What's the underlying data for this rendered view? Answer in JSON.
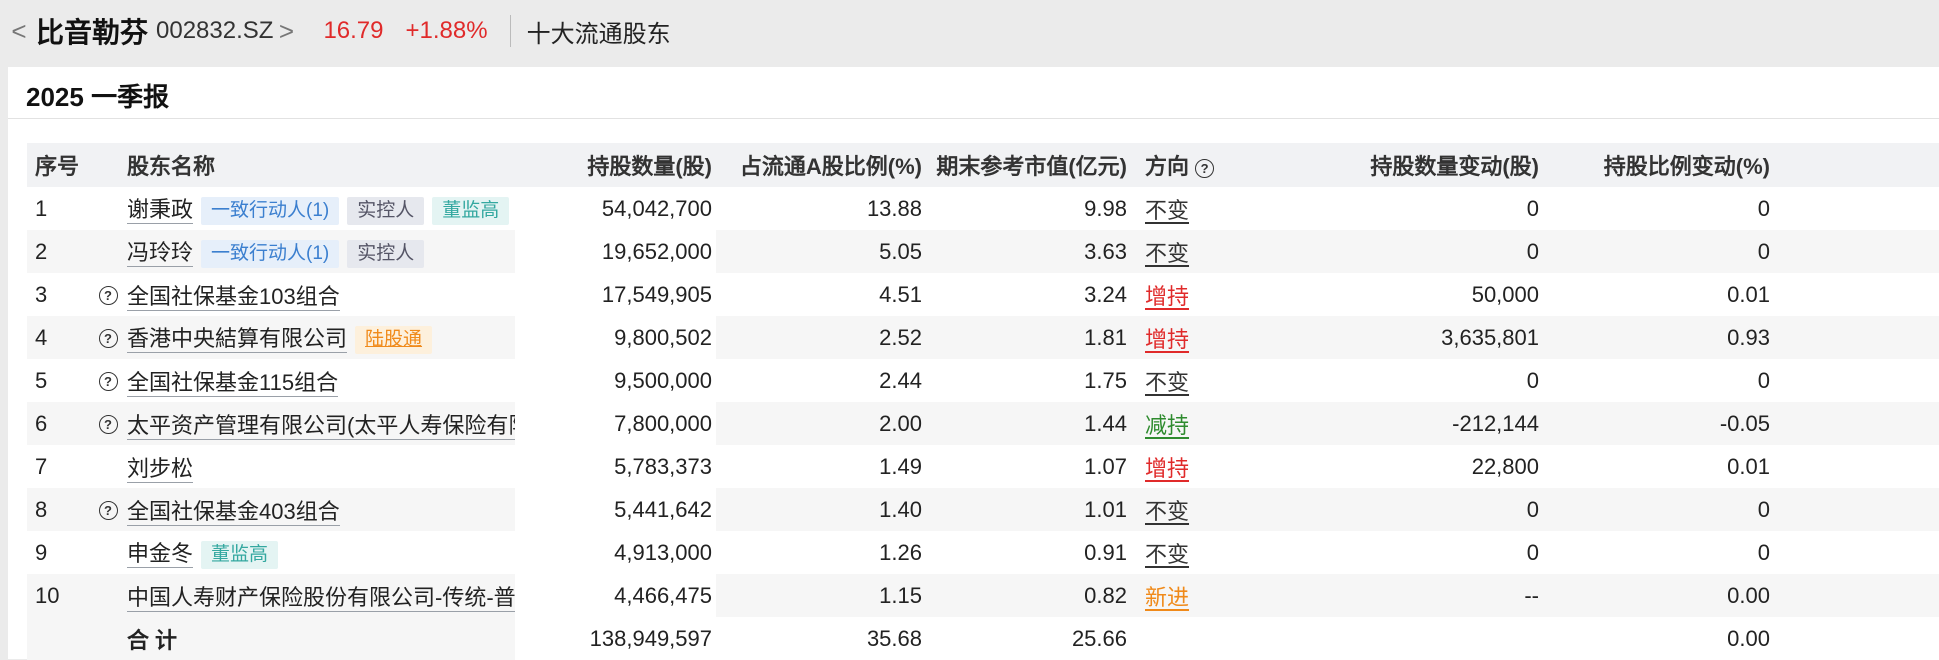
{
  "header": {
    "back_glyph": "<",
    "stock_name": "比音勒芬",
    "stock_code": "002832.SZ",
    "forward_glyph": ">",
    "price": "16.79",
    "change_pct": "+1.88%",
    "section": "十大流通股东"
  },
  "report": {
    "title": "2025 一季报"
  },
  "table": {
    "columns": {
      "idx": "序号",
      "name": "股东名称",
      "shares": "持股数量(股)",
      "ratio": "占流通A股比例(%)",
      "value": "期末参考市值(亿元)",
      "direction": "方向",
      "share_change": "持股数量变动(股)",
      "ratio_change": "持股比例变动(%)"
    },
    "rows": [
      {
        "idx": "1",
        "icon": false,
        "name": "谢秉政",
        "tags": [
          {
            "text": "一致行动人(1)",
            "style": "blue"
          },
          {
            "text": "实控人",
            "style": "gray"
          },
          {
            "text": "董监高",
            "style": "teal"
          }
        ],
        "shares": "54,042,700",
        "ratio": "13.88",
        "value": "9.98",
        "direction": "不变",
        "dir_type": "flat",
        "share_change": "0",
        "ratio_change": "0"
      },
      {
        "idx": "2",
        "icon": false,
        "name": "冯玲玲",
        "tags": [
          {
            "text": "一致行动人(1)",
            "style": "blue"
          },
          {
            "text": "实控人",
            "style": "gray"
          }
        ],
        "shares": "19,652,000",
        "ratio": "5.05",
        "value": "3.63",
        "direction": "不变",
        "dir_type": "flat",
        "share_change": "0",
        "ratio_change": "0"
      },
      {
        "idx": "3",
        "icon": true,
        "name": "全国社保基金103组合",
        "tags": [],
        "shares": "17,549,905",
        "ratio": "4.51",
        "value": "3.24",
        "direction": "增持",
        "dir_type": "up",
        "share_change": "50,000",
        "ratio_change": "0.01"
      },
      {
        "idx": "4",
        "icon": true,
        "name": "香港中央結算有限公司",
        "tags": [
          {
            "text": "陆股通",
            "style": "orange"
          }
        ],
        "shares": "9,800,502",
        "ratio": "2.52",
        "value": "1.81",
        "direction": "增持",
        "dir_type": "up",
        "share_change": "3,635,801",
        "ratio_change": "0.93"
      },
      {
        "idx": "5",
        "icon": true,
        "name": "全国社保基金115组合",
        "tags": [],
        "shares": "9,500,000",
        "ratio": "2.44",
        "value": "1.75",
        "direction": "不变",
        "dir_type": "flat",
        "share_change": "0",
        "ratio_change": "0"
      },
      {
        "idx": "6",
        "icon": true,
        "name": "太平资产管理有限公司(太平人寿保险有限公…",
        "tags": [],
        "shares": "7,800,000",
        "ratio": "2.00",
        "value": "1.44",
        "direction": "减持",
        "dir_type": "down",
        "share_change": "-212,144",
        "ratio_change": "-0.05"
      },
      {
        "idx": "7",
        "icon": false,
        "name": "刘步松",
        "tags": [],
        "shares": "5,783,373",
        "ratio": "1.49",
        "value": "1.07",
        "direction": "增持",
        "dir_type": "up",
        "share_change": "22,800",
        "ratio_change": "0.01"
      },
      {
        "idx": "8",
        "icon": true,
        "name": "全国社保基金403组合",
        "tags": [],
        "shares": "5,441,642",
        "ratio": "1.40",
        "value": "1.01",
        "direction": "不变",
        "dir_type": "flat",
        "share_change": "0",
        "ratio_change": "0"
      },
      {
        "idx": "9",
        "icon": false,
        "name": "申金冬",
        "tags": [
          {
            "text": "董监高",
            "style": "teal"
          }
        ],
        "shares": "4,913,000",
        "ratio": "1.26",
        "value": "0.91",
        "direction": "不变",
        "dir_type": "flat",
        "share_change": "0",
        "ratio_change": "0"
      },
      {
        "idx": "10",
        "icon": false,
        "name": "中国人寿财产保险股份有限公司-传统-普通…",
        "tags": [],
        "shares": "4,466,475",
        "ratio": "1.15",
        "value": "0.82",
        "direction": "新进",
        "dir_type": "new",
        "share_change": "--",
        "ratio_change": "0.00"
      }
    ],
    "total": {
      "label": "合计",
      "shares": "138,949,597",
      "ratio": "35.68",
      "value": "25.66",
      "ratio_change": "0.00"
    }
  },
  "icons": {
    "help": "?"
  },
  "colors": {
    "up": "#e02a2a",
    "down": "#2e8b2e",
    "new": "#f08a1a",
    "header_bg": "#f1f2f4"
  }
}
